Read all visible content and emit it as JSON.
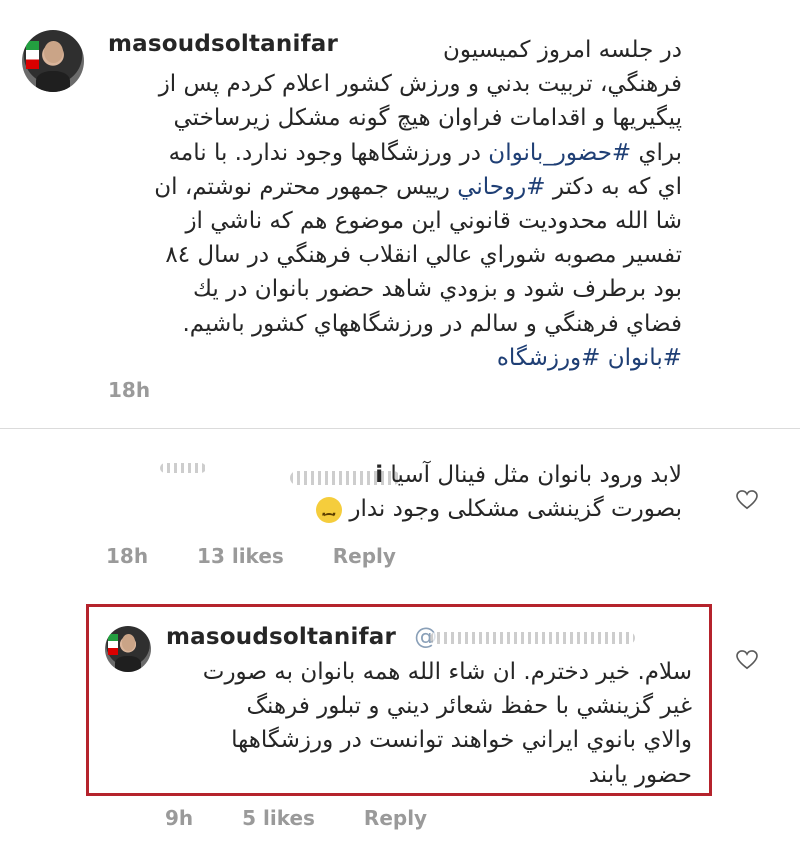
{
  "post": {
    "username": "masoudsoltanifar",
    "lines": [
      "در جلسه امروز كميسيون",
      "فرهنگي، تربيت بدني و ورزش كشور اعلام كردم پس از",
      "پيگيريها و اقدامات فراوان هيچ گونه مشكل زيرساختي",
      "براي #حضور_بانوان در ورزشگاهها وجود ندارد.  با نامه",
      "اي كه به دكتر #روحاني رييس جمهور محترم نوشتم، ان",
      "شا الله محدوديت قانوني اين موضوع هم كه ناشي از",
      "تفسير مصوبه شوراي عالي انقلاب فرهنگي در سال ٨٤",
      "بود برطرف شود و بزودي شاهد حضور بانوان در يك",
      "فضاي فرهنگي و سالم در ورزشگاههاي كشور  باشيم.",
      "#بانوان #ورزشگاه"
    ],
    "time": "18h"
  },
  "comment1": {
    "line1": "لابد ورود بانوان مثل فينال آسيا",
    "line2": "بصورت گزينشی مشكلی وجود ندار",
    "username_fragment": "i",
    "time": "18h",
    "likes": "13 likes",
    "reply": "Reply",
    "emoji": "sad-face"
  },
  "reply": {
    "username": "masoudsoltanifar",
    "mention_fragment": "@",
    "lines": [
      "سلام. خير دخترم. ان شاء الله همه بانوان به صورت",
      "غير گزينشي با حفظ شعائر ديني و تبلور فرهنگ",
      "والاي بانوي ايراني خواهند توانست در ورزشگاهها",
      "حضور يابند"
    ],
    "time": "9h",
    "likes": "5 likes",
    "reply_label": "Reply"
  },
  "colors": {
    "hashtag": "#1f3f75",
    "highlight_border": "#b5232c",
    "meta_gray": "#9a9a9a"
  }
}
